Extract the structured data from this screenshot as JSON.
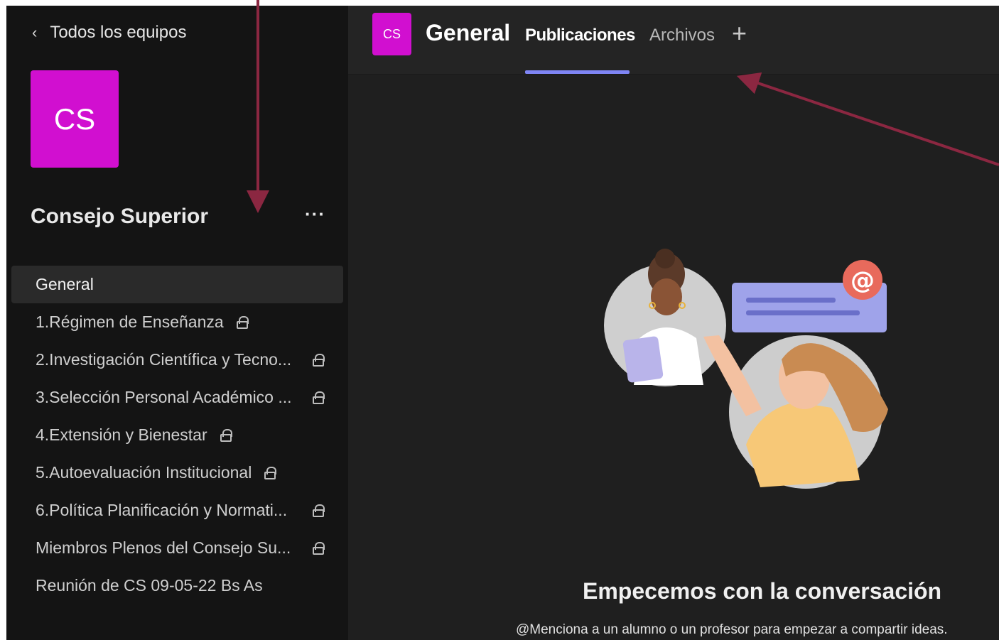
{
  "sidebar": {
    "back_label": "Todos los equipos",
    "team_initials": "CS",
    "team_name": "Consejo Superior",
    "more_label": "···",
    "channels": [
      {
        "label": "General",
        "private": false,
        "active": true
      },
      {
        "label": "1.Régimen de Enseñanza",
        "private": true
      },
      {
        "label": "2.Investigación Científica y Tecno...",
        "private": true
      },
      {
        "label": "3.Selección Personal Académico ...",
        "private": true
      },
      {
        "label": "4.Extensión y Bienestar",
        "private": true
      },
      {
        "label": "5.Autoevaluación Institucional",
        "private": true
      },
      {
        "label": "6.Política Planificación y Normati...",
        "private": true
      },
      {
        "label": "Miembros Plenos del Consejo Su...",
        "private": true
      },
      {
        "label": "Reunión de CS 09-05-22 Bs As",
        "private": false
      }
    ]
  },
  "header": {
    "channel_initials": "CS",
    "channel_title": "General",
    "tabs": [
      "Publicaciones",
      "Archivos"
    ],
    "add_tab": "+"
  },
  "main": {
    "empty_title": "Empecemos con la conversación",
    "empty_subtitle": "@Menciona a un alumno o un profesor para empezar a compartir ideas."
  },
  "colors": {
    "accent": "#7f85f5",
    "team_color": "#d10fd0",
    "annotation": "#8b2741"
  }
}
